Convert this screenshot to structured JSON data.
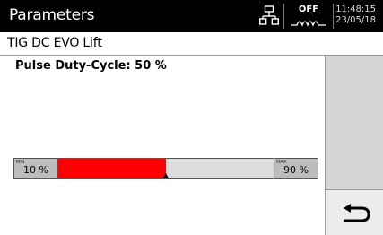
{
  "header": {
    "title": "Parameters",
    "network_icon": "network-icon",
    "status": "OFF",
    "wave_icon": "wave-icon",
    "time": "11:48:15",
    "date": "23/05/18"
  },
  "subheader": {
    "mode": "TIG  DC  EVO Lift"
  },
  "parameter": {
    "label": "Pulse Duty-Cycle: 50 %",
    "min_tag": "MIN",
    "min_value": "10 %",
    "max_tag": "MAX",
    "max_value": "90 %",
    "min": 10,
    "max": 90,
    "value": 50
  },
  "colors": {
    "fill": "#ff0000",
    "track": "#dcdcdc",
    "header_bg": "#000000"
  },
  "actions": {
    "back_icon": "return-arrow-icon"
  }
}
